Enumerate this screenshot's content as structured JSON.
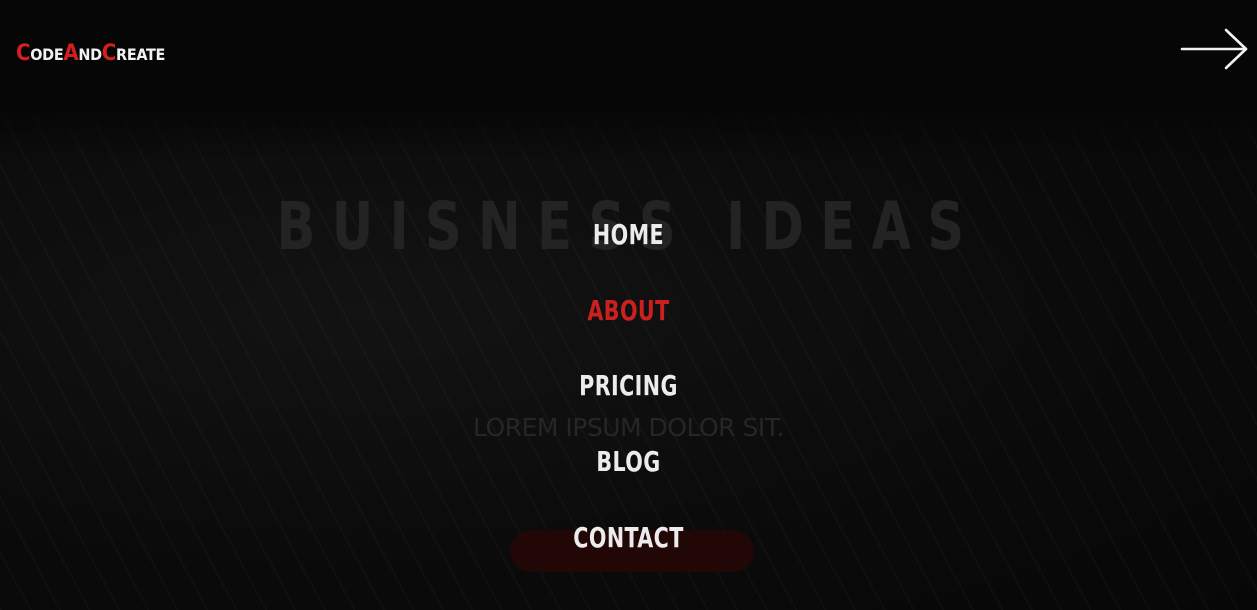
{
  "brand": {
    "logo_parts": [
      {
        "cap": "C",
        "rest": "ode"
      },
      {
        "cap": "A",
        "rest": "nd"
      },
      {
        "cap": "C",
        "rest": "reate"
      }
    ],
    "accent_color": "#d51f1f"
  },
  "header": {
    "arrow_icon": "arrow-right-icon"
  },
  "hero": {
    "title": "BUISNESS IDEAS",
    "subtitle": "LOREM IPSUM DOLOR SIT."
  },
  "nav": {
    "items": [
      {
        "label": "HOME",
        "active": false
      },
      {
        "label": "ABOUT",
        "active": true
      },
      {
        "label": "PRICING",
        "active": false
      },
      {
        "label": "BLOG",
        "active": false
      },
      {
        "label": "CONTACT",
        "active": false
      }
    ],
    "text_color": "#ececec",
    "active_color": "#cc2020"
  }
}
